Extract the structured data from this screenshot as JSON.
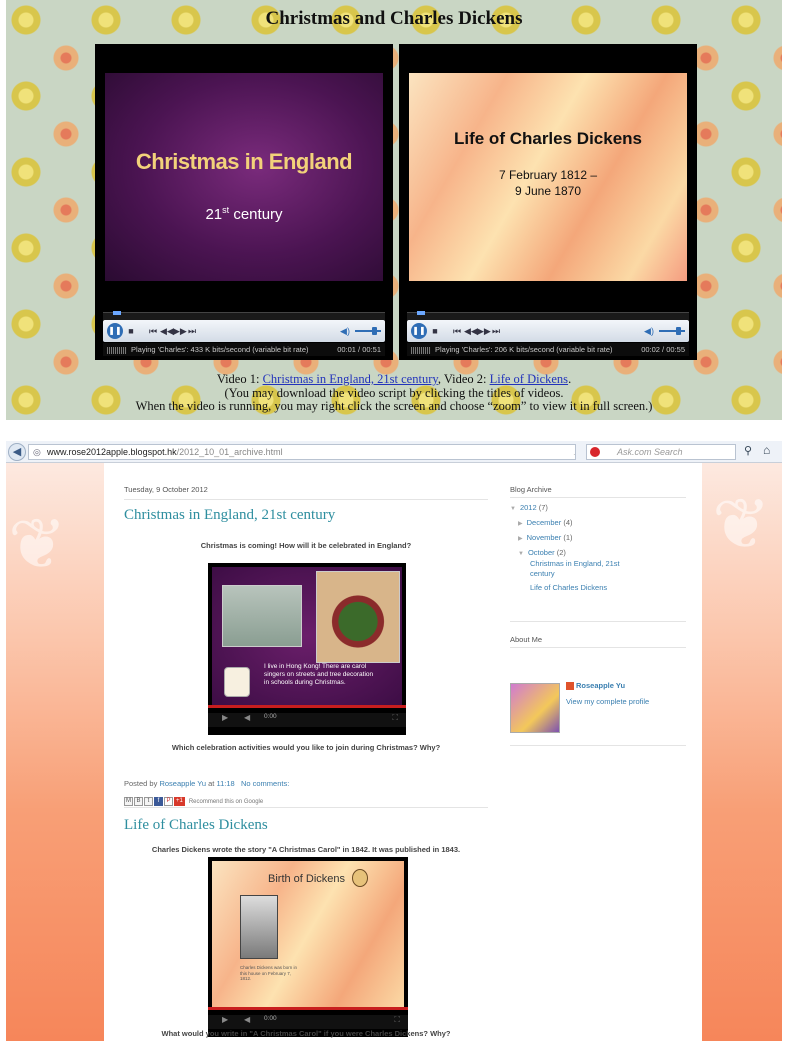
{
  "top": {
    "title": "Christmas and Charles Dickens",
    "player1": {
      "slide_title": "Christmas in England",
      "slide_sub_main": "21",
      "slide_sub_sup": "st",
      "slide_sub_tail": " century",
      "status": "Playing 'Charles': 433 K bits/second (variable bit rate)",
      "time": "00:01 / 00:51"
    },
    "player2": {
      "slide_title": "Life of Charles Dickens",
      "slide_line1": "7 February 1812 –",
      "slide_line2": "9 June 1870",
      "status": "Playing 'Charles': 206 K bits/second (variable bit rate)",
      "time": "00:02 / 00:55"
    },
    "caption": {
      "prefix1": "Video 1: ",
      "link1": "Christmas in England, 21st century",
      "mid": ", Video 2: ",
      "link2": "Life of Dickens",
      "suffix": ".",
      "line2": "(You may download the video script by clicking the titles of videos.",
      "line3": "When the video is running, you may right click the screen and choose “zoom” to view it in full screen.)"
    }
  },
  "browser": {
    "url_host": "www.rose2012apple.blogspot.hk",
    "url_path": "/2012_10_01_archive.html",
    "search_placeholder": "Ask.com Search"
  },
  "blog": {
    "date_header": "Tuesday, 9 October 2012",
    "post1": {
      "title": "Christmas in England, 21st century",
      "intro": "Christmas is coming! How will it be celebrated in England?",
      "video_text": "I live in Hong Kong! There are carol singers on streets and tree decoration in schools during Christmas.",
      "video_time": "0:00",
      "question": "Which celebration activities would you like to join during Christmas? Why?",
      "posted_by_label": "Posted by ",
      "author": "Roseapple Yu",
      "at_label": " at ",
      "time": "11:18",
      "comments": "No comments:",
      "recommend": "Recommend this on Google",
      "plus_one": "+1"
    },
    "post2": {
      "title": "Life of Charles Dickens",
      "intro": "Charles Dickens wrote the story \"A Christmas Carol\" in 1842. It was published in 1843.",
      "video_title": "Birth of Dickens",
      "video_caption": "Charles Dickens was born in this house on February 7, 1812.",
      "video_time": "0:00",
      "question": "What would you write in \"A Christmas Carol\" if you were Charles Dickens? Why?"
    },
    "sidebar": {
      "archive_heading": "Blog Archive",
      "year": "2012",
      "year_count": "(7)",
      "months": [
        {
          "name": "December",
          "count": "(4)"
        },
        {
          "name": "November",
          "count": "(1)"
        },
        {
          "name": "October",
          "count": "(2)"
        }
      ],
      "october_posts": [
        "Christmas in England, 21st century",
        "Life of Charles Dickens"
      ],
      "about_heading": "About Me",
      "profile_name": "Roseapple Yu",
      "profile_link": "View my complete profile"
    }
  }
}
